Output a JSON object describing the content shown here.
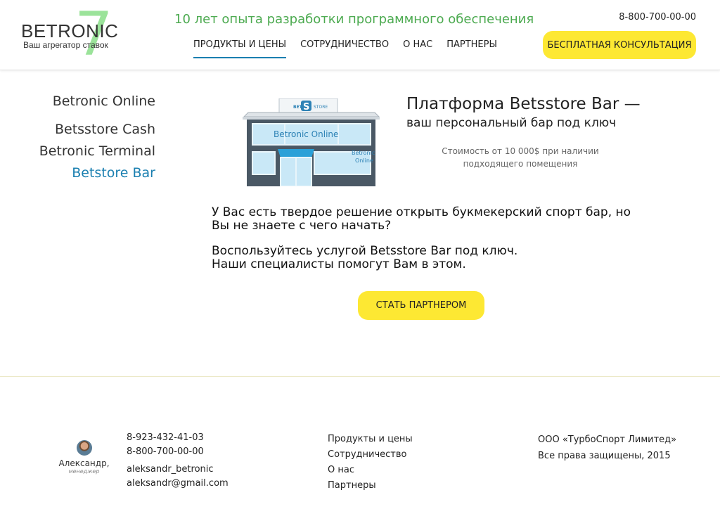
{
  "header": {
    "logo_text": "BETRONIC",
    "logo_number": "7",
    "logo_tagline": "Ваш агрегатор ставок",
    "tagline": "10 лет опыта разработки программного обеспечения",
    "phone": "8-800-700-00-00",
    "consult_button": "БЕСПЛАТНАЯ КОНСУЛЬТАЦИЯ",
    "nav": [
      {
        "label": "ПРОДУКТЫ И ЦЕНЫ",
        "active": true
      },
      {
        "label": "СОТРУДНИЧЕСТВО"
      },
      {
        "label": "О НАС"
      },
      {
        "label": "ПАРТНЕРЫ"
      }
    ]
  },
  "sidebar": {
    "items": [
      {
        "label": "Betronic Online"
      },
      {
        "label": "Betsstore Cash"
      },
      {
        "label": "Betronic Terminal"
      },
      {
        "label": "Betstore Bar",
        "active": true
      }
    ]
  },
  "shop": {
    "sign_left": "BETS",
    "sign_letter": "S",
    "sign_right": "STORE",
    "window_text": "Betronic Online",
    "side_text_1": "Betronic",
    "side_text_2": "Online"
  },
  "main": {
    "headline": "Платформа Betsstore Bar —",
    "subheadline": "ваш персональный бар под ключ",
    "price_note": "Стоимость от 10 000$ при наличии подходящего помещения",
    "paragraph_1": "У Вас есть твердое решение открыть букмекерский спорт бар, но Вы не знаете с чего начать?",
    "paragraph_2_line_1": "Воспользуйтесь услугой Betsstore Bar под ключ.",
    "paragraph_2_line_2": "Наши специалисты помогут  Вам в этом.",
    "partner_button": "СТАТЬ ПАРТНЕРОМ"
  },
  "footer": {
    "manager_name": "Александр,",
    "manager_role": "менеджер",
    "phone_1": "8-923-432-41-03",
    "phone_2": "8-800-700-00-00",
    "skype": "aleksandr_betronic",
    "email": "aleksandr@gmail.com",
    "links": [
      "Продукты и цены",
      "Сотрудничество",
      "О нас",
      "Партнеры"
    ],
    "company": "ООО «ТурбоСпорт Лимитед»",
    "rights": "Все права защищены, 2015"
  },
  "colors": {
    "accent_yellow": "#fde833",
    "accent_green": "#4caa50",
    "logo_green": "#9be39a",
    "link_blue": "#1a7fb0"
  }
}
